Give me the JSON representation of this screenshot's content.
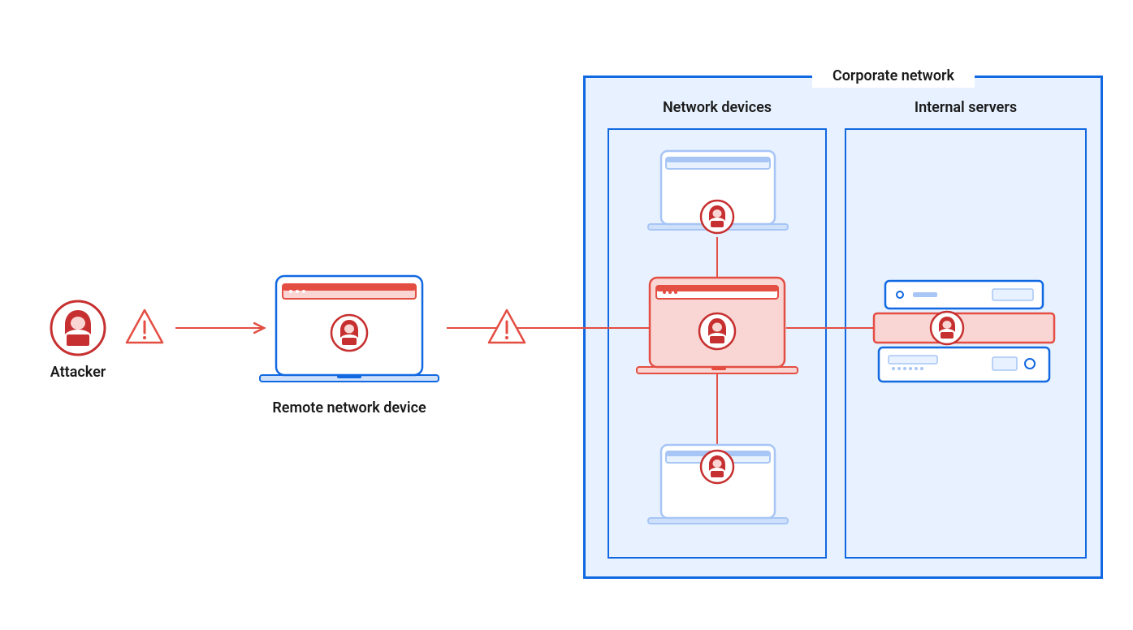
{
  "attacker_label": "Attacker",
  "remote_label": "Remote network device",
  "corporate_label": "Corporate network",
  "network_devices_label": "Network devices",
  "internal_servers_label": "Internal servers",
  "colors": {
    "blue": "#1169e1",
    "blue_light": "#a7c5f5",
    "blue_fill": "#e7f1ff",
    "red": "#c73030",
    "red_light": "#f9d6d4",
    "red_bar": "#e44d42"
  },
  "diagram": {
    "nodes": [
      {
        "id": "attacker",
        "type": "attacker-badge",
        "role": "source"
      },
      {
        "id": "remote",
        "type": "laptop-red",
        "label_key": "remote_label"
      },
      {
        "id": "nd-top",
        "type": "laptop-blue-small",
        "compromised": true
      },
      {
        "id": "nd-mid",
        "type": "laptop-red-large",
        "compromised": true
      },
      {
        "id": "nd-bot",
        "type": "laptop-blue-small",
        "compromised": true
      },
      {
        "id": "servers",
        "type": "server-stack",
        "compromised_unit": "middle"
      }
    ],
    "edges": [
      {
        "from": "attacker",
        "to": "remote",
        "marker": "warning"
      },
      {
        "from": "remote",
        "to": "nd-mid",
        "marker": "warning"
      },
      {
        "from": "nd-mid",
        "to": "nd-top"
      },
      {
        "from": "nd-mid",
        "to": "nd-bot"
      },
      {
        "from": "nd-mid",
        "to": "servers"
      }
    ],
    "groups": [
      {
        "id": "corporate",
        "label_key": "corporate_label",
        "children": [
          "network_devices",
          "internal_servers"
        ]
      },
      {
        "id": "network_devices",
        "label_key": "network_devices_label",
        "children": [
          "nd-top",
          "nd-mid",
          "nd-bot"
        ]
      },
      {
        "id": "internal_servers",
        "label_key": "internal_servers_label",
        "children": [
          "servers"
        ]
      }
    ]
  }
}
